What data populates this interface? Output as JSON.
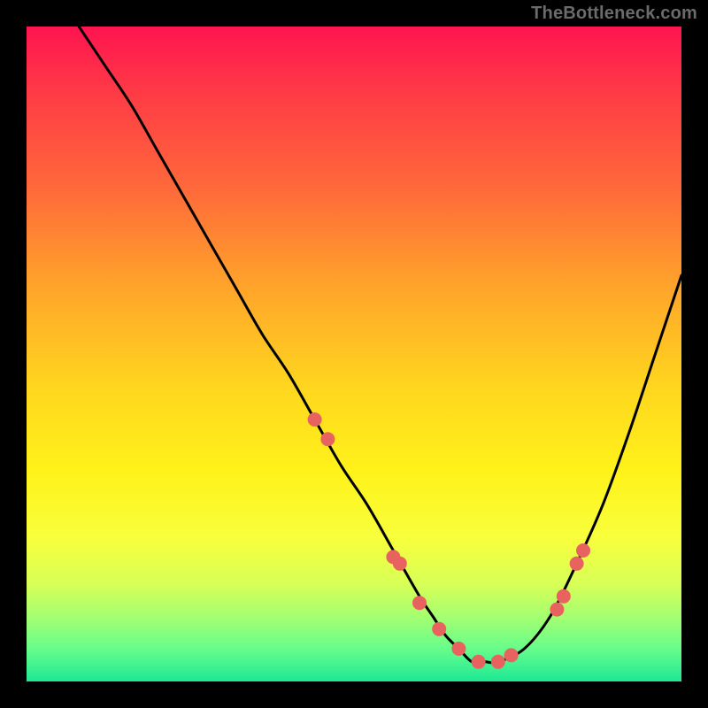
{
  "watermark": "TheBottleneck.com",
  "chart_data": {
    "type": "line",
    "title": "",
    "xlabel": "",
    "ylabel": "",
    "xlim": [
      0,
      100
    ],
    "ylim": [
      0,
      100
    ],
    "grid": false,
    "legend": false,
    "background_gradient": [
      "#ff1450",
      "#ffd61f",
      "#1ee895"
    ],
    "series": [
      {
        "name": "bottleneck-curve",
        "type": "line",
        "color": "#000000",
        "x": [
          8,
          12,
          16,
          20,
          24,
          28,
          32,
          36,
          40,
          44,
          48,
          52,
          56,
          60,
          62,
          64,
          66,
          68,
          70,
          72,
          76,
          80,
          84,
          88,
          92,
          96,
          100
        ],
        "y": [
          100,
          94,
          88,
          81,
          74,
          67,
          60,
          53,
          47,
          40,
          33,
          27,
          20,
          13,
          10,
          7,
          5,
          3,
          3,
          3,
          5,
          10,
          18,
          27,
          38,
          50,
          62
        ]
      },
      {
        "name": "highlight-points",
        "type": "scatter",
        "color": "#e8635f",
        "x": [
          44,
          46,
          56,
          57,
          60,
          63,
          66,
          69,
          72,
          74,
          81,
          82,
          84,
          85
        ],
        "y": [
          40,
          37,
          19,
          18,
          12,
          8,
          5,
          3,
          3,
          4,
          11,
          13,
          18,
          20
        ]
      }
    ]
  }
}
